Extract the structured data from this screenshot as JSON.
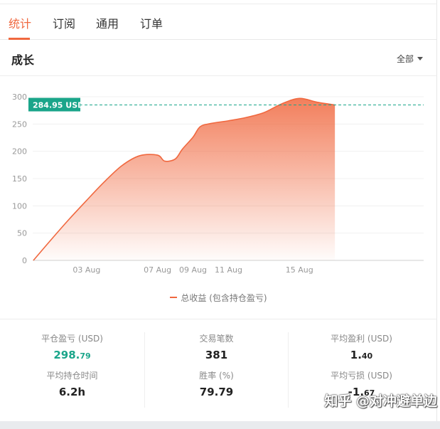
{
  "tabs": [
    {
      "label": "统计",
      "active": true
    },
    {
      "label": "订阅",
      "active": false
    },
    {
      "label": "通用",
      "active": false
    },
    {
      "label": "订单",
      "active": false
    }
  ],
  "section": {
    "title": "成长",
    "range_label": "全部"
  },
  "colors": {
    "accent": "#f0683f",
    "positive": "#1aa58a",
    "reference_line": "#1aa58a"
  },
  "chart_data": {
    "type": "area",
    "x_ticks": [
      "03 Aug",
      "07 Aug",
      "09 Aug",
      "11 Aug",
      "15 Aug"
    ],
    "y_ticks": [
      "0",
      "50",
      "100",
      "150",
      "200",
      "250",
      "300"
    ],
    "ylim": [
      0,
      300
    ],
    "grid": true,
    "legend_position": "bottom",
    "reference": {
      "value": 284.95,
      "label": "284.95 USD"
    },
    "series": [
      {
        "name": "总收益 (包含持仓盈亏)",
        "points": [
          [
            "Jul 31",
            0
          ],
          [
            "Aug 01",
            38
          ],
          [
            "Aug 02",
            75
          ],
          [
            "Aug 03",
            110
          ],
          [
            "Aug 04",
            144
          ],
          [
            "Aug 05",
            174
          ],
          [
            "Aug 06",
            192
          ],
          [
            "Aug 07",
            193
          ],
          [
            "Aug 07",
            182
          ],
          [
            "Aug 08",
            186
          ],
          [
            "Aug 08",
            204
          ],
          [
            "Aug 09",
            226
          ],
          [
            "Aug 09",
            245
          ],
          [
            "Aug 10",
            251
          ],
          [
            "Aug 11",
            256
          ],
          [
            "Aug 12",
            262
          ],
          [
            "Aug 13",
            271
          ],
          [
            "Aug 14",
            287
          ],
          [
            "Aug 15",
            297
          ],
          [
            "Aug 16",
            290
          ],
          [
            "Aug 17",
            285
          ]
        ]
      }
    ]
  },
  "stats": {
    "realized_pnl": {
      "label": "平仓盈亏 (USD)",
      "int": "298.",
      "dec": "79"
    },
    "trade_count": {
      "label": "交易笔数",
      "value": "381"
    },
    "avg_profit": {
      "label": "平均盈利 (USD)",
      "int": "1.",
      "dec": "40"
    },
    "avg_hold_time": {
      "label": "平均持仓时间",
      "value": "6.2h"
    },
    "win_rate": {
      "label": "胜率 (%)",
      "value": "79.79"
    },
    "avg_loss": {
      "label": "平均亏损 (USD)",
      "int": "-1.",
      "dec": "67"
    }
  },
  "watermark": "知乎 @对冲避单边"
}
